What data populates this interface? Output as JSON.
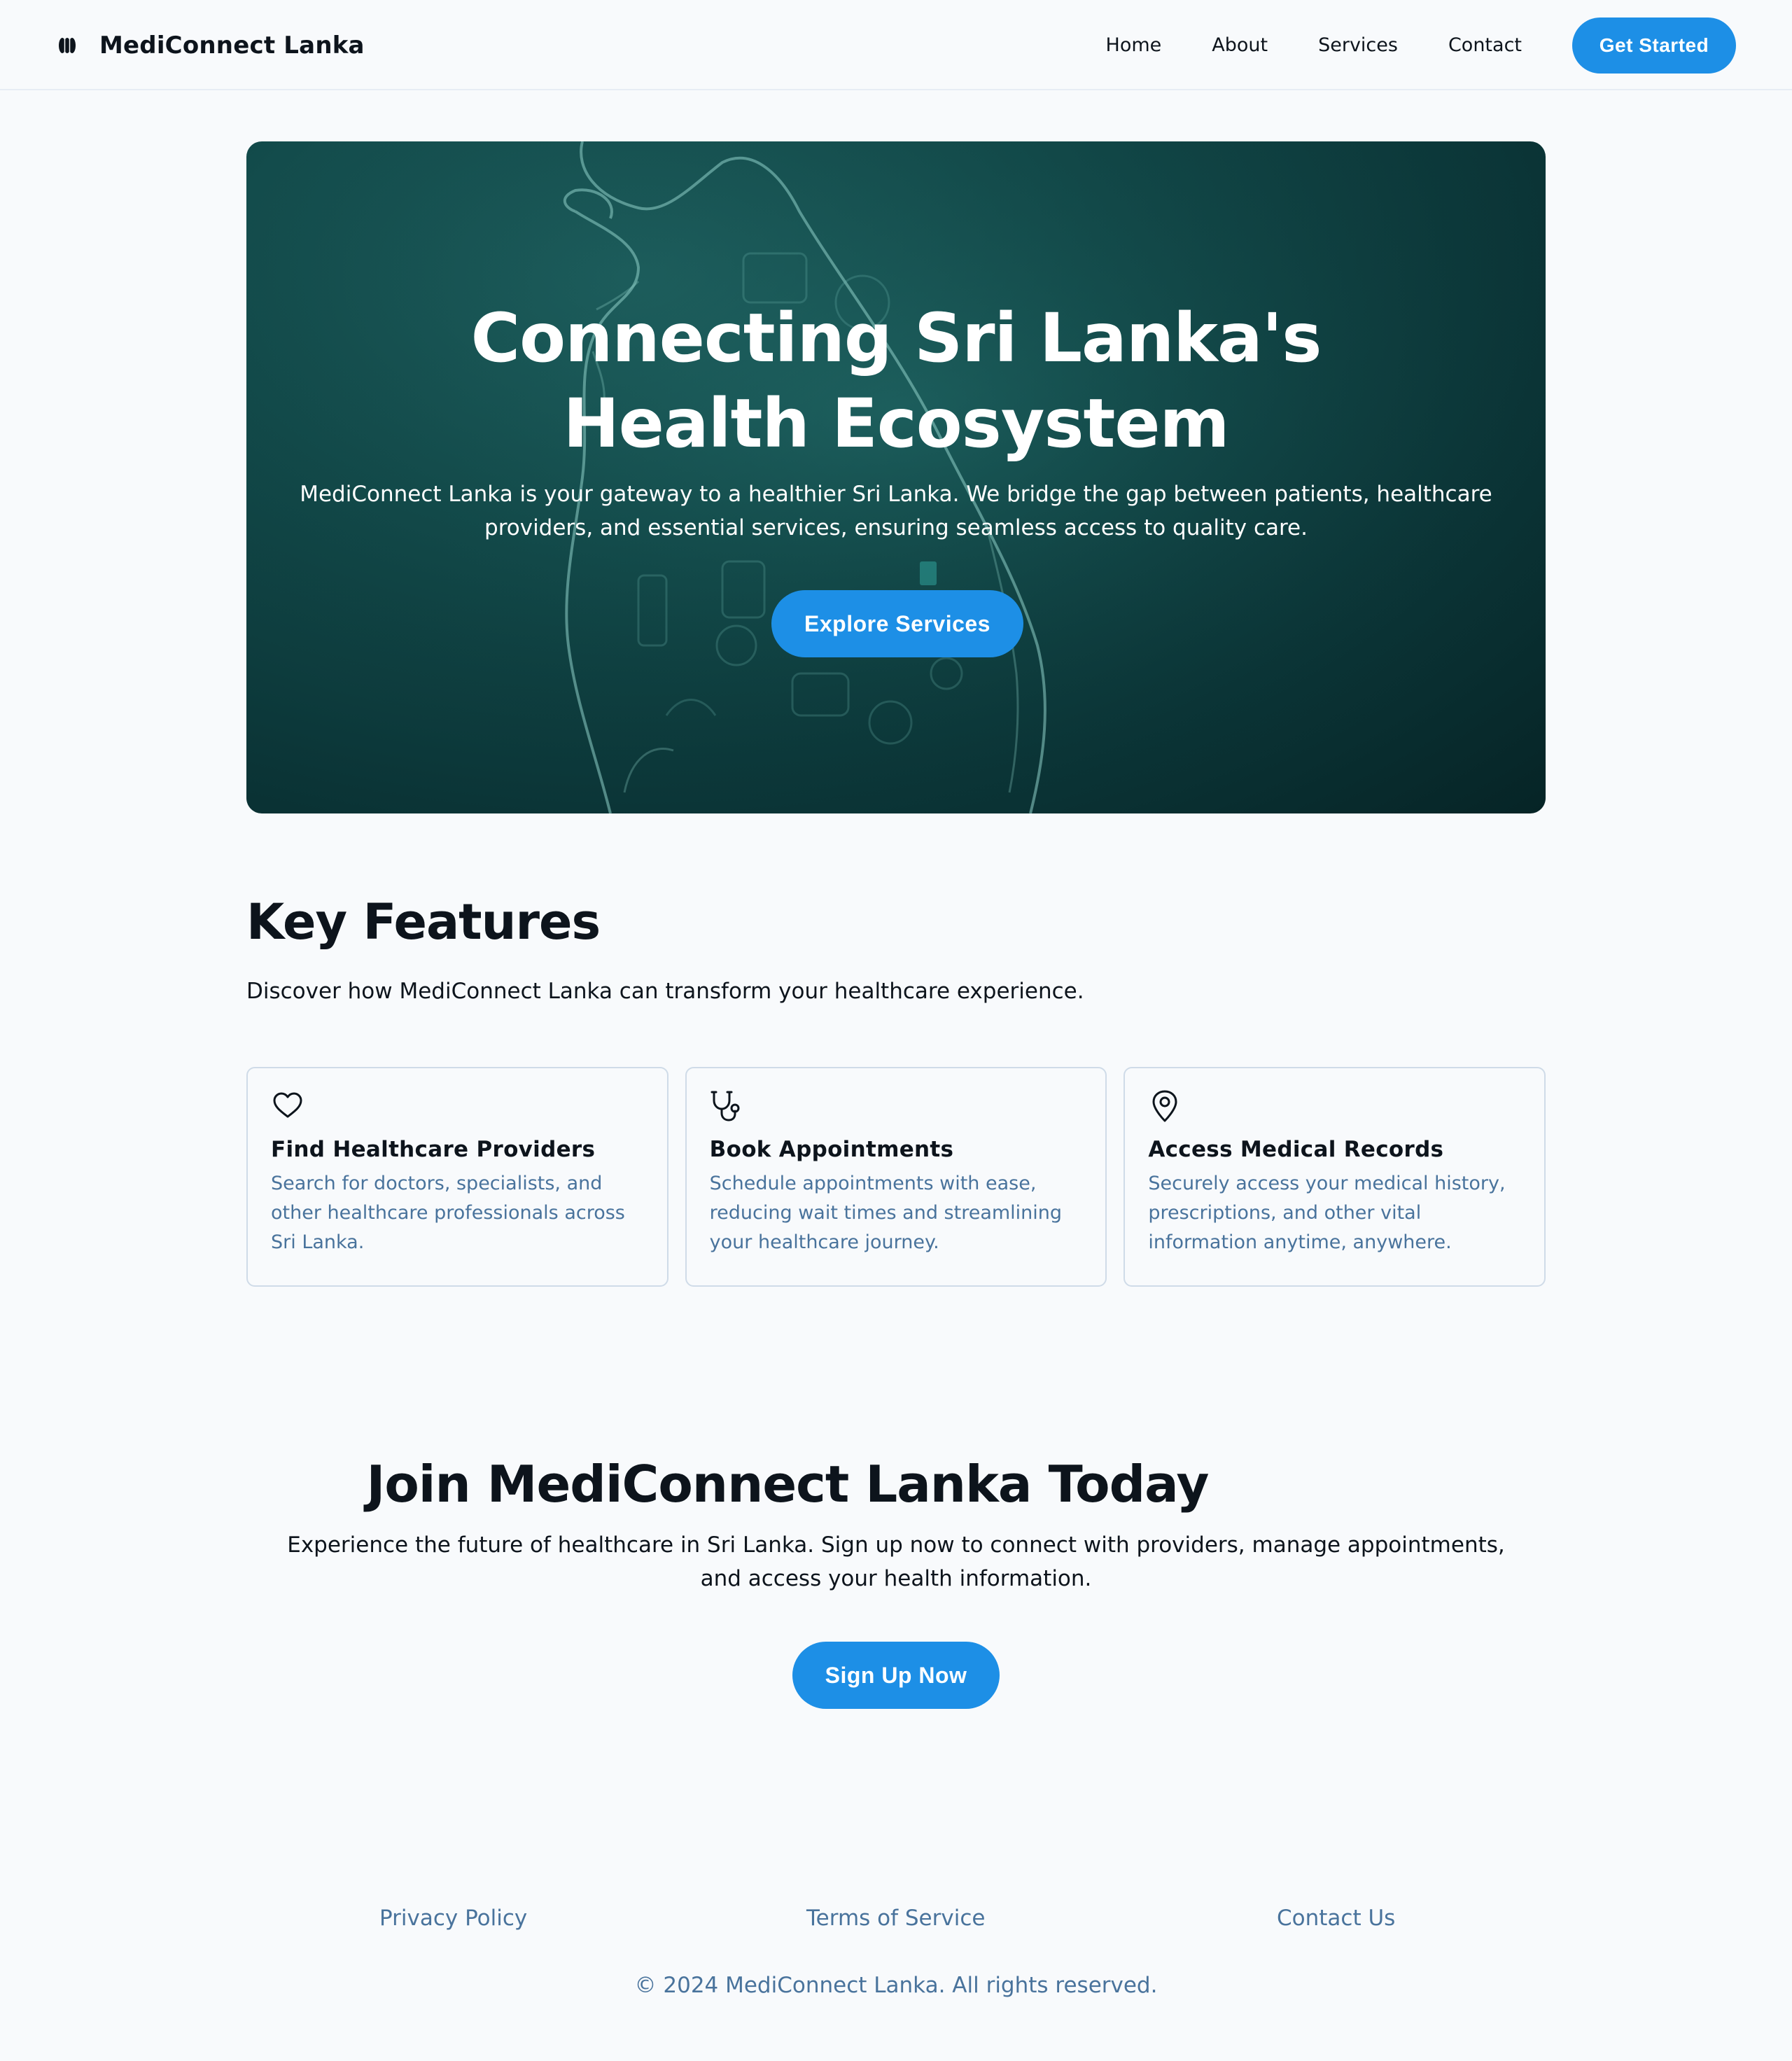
{
  "header": {
    "brand": "MediConnect Lanka",
    "logo_icon": "brand-logo-icon",
    "nav": [
      "Home",
      "About",
      "Services",
      "Contact"
    ],
    "cta": "Get Started"
  },
  "hero": {
    "title": "Connecting Sri Lanka's Health Ecosystem",
    "subtitle": "MediConnect Lanka is your gateway to a healthier Sri Lanka. We bridge the gap between patients, healthcare providers, and essential services, ensuring seamless access to quality care.",
    "button": "Explore Services"
  },
  "features": {
    "title": "Key Features",
    "subtitle": "Discover how MediConnect Lanka can transform your healthcare experience.",
    "cards": [
      {
        "icon": "heart-icon",
        "title": "Find Healthcare Providers",
        "desc": "Search for doctors, specialists, and other healthcare professionals across Sri Lanka."
      },
      {
        "icon": "stethoscope-icon",
        "title": "Book Appointments",
        "desc": "Schedule appointments with ease, reducing wait times and streamlining your healthcare journey."
      },
      {
        "icon": "map-pin-icon",
        "title": "Access Medical Records",
        "desc": "Securely access your medical history, prescriptions, and other vital information anytime, anywhere."
      }
    ]
  },
  "join": {
    "title": "Join MediConnect Lanka Today",
    "subtitle": "Experience the future of healthcare in Sri Lanka. Sign up now to connect with providers, manage appointments, and access your health information.",
    "button": "Sign Up Now"
  },
  "footer": {
    "links": [
      "Privacy Policy",
      "Terms of Service",
      "Contact Us"
    ],
    "copyright": "© 2024 MediConnect Lanka. All rights reserved."
  },
  "colors": {
    "accent": "#1d8fe6",
    "text_dark": "#0d141c",
    "text_muted": "#49739c",
    "hero_bg": "#124a4a",
    "border": "#cfdbe8"
  }
}
